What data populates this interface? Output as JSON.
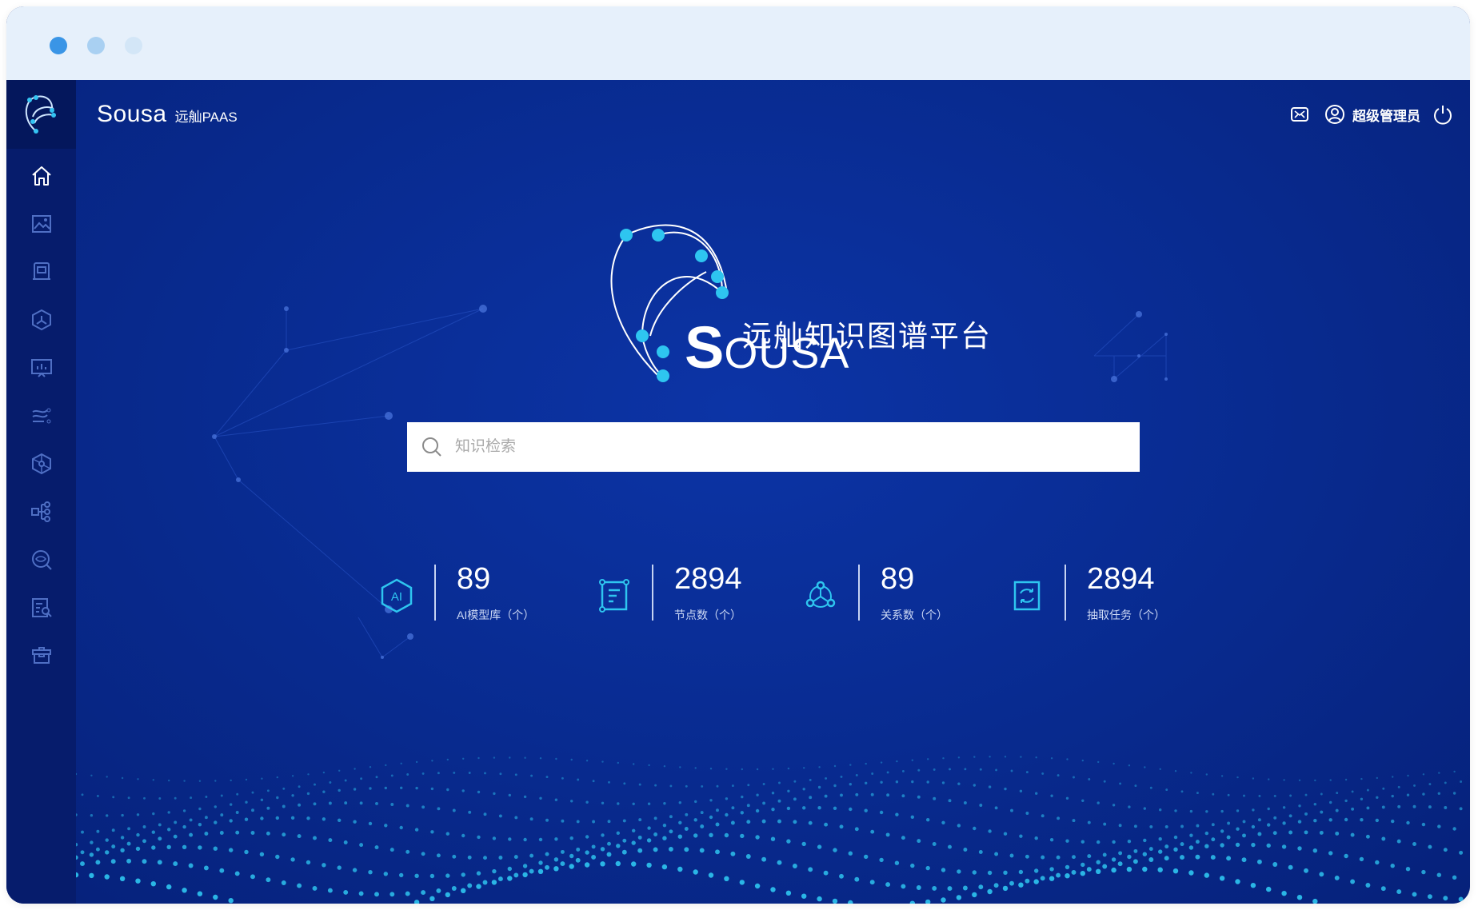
{
  "window": {
    "controls": [
      "close",
      "minimize",
      "maximize"
    ]
  },
  "brand": {
    "name": "Sousa",
    "subtitle": "远舢PAAS"
  },
  "header": {
    "user_name": "超级管理员",
    "icons": [
      "mail-icon",
      "user-icon",
      "power-icon"
    ]
  },
  "sidebar": {
    "logo_icon": "sousa-logo-icon",
    "items": [
      {
        "name": "home",
        "icon": "home-icon"
      },
      {
        "name": "image",
        "icon": "image-icon"
      },
      {
        "name": "model",
        "icon": "model-icon"
      },
      {
        "name": "graph",
        "icon": "hexagon-graph-icon"
      },
      {
        "name": "dashboard",
        "icon": "dashboard-icon"
      },
      {
        "name": "flow",
        "icon": "flow-icon"
      },
      {
        "name": "network",
        "icon": "network-icon"
      },
      {
        "name": "tree",
        "icon": "tree-icon"
      },
      {
        "name": "search-view",
        "icon": "eye-search-icon"
      },
      {
        "name": "doc-search",
        "icon": "doc-search-icon"
      },
      {
        "name": "toolbox",
        "icon": "toolbox-icon"
      }
    ]
  },
  "hero": {
    "title": "远舢知识图谱平台",
    "word_initial": "S",
    "word_rest": "OUSA"
  },
  "search": {
    "placeholder": "知识检索",
    "value": ""
  },
  "stats": [
    {
      "value": "89",
      "label": "AI模型库（个）",
      "icon": "ai-hexagon-icon",
      "icon_text": "AI"
    },
    {
      "value": "2894",
      "label": "节点数（个）",
      "icon": "node-doc-icon"
    },
    {
      "value": "89",
      "label": "关系数（个）",
      "icon": "relation-graph-icon"
    },
    {
      "value": "2894",
      "label": "抽取任务（个）",
      "icon": "extract-task-icon"
    }
  ],
  "colors": {
    "background": "#0a2a8a",
    "sidebar": "#061c6c",
    "accent": "#2ec5f0",
    "titlebar": "#e6f0fb"
  }
}
